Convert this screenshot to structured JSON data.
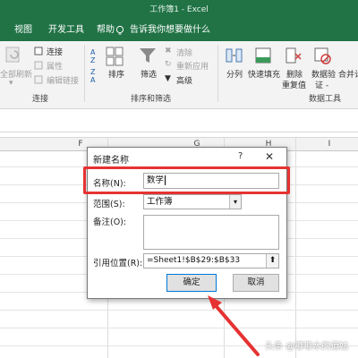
{
  "window": {
    "title": "工作簿1  -  Excel"
  },
  "tabs": [
    {
      "label": "视图"
    },
    {
      "label": "开发工具"
    },
    {
      "label": "帮助"
    }
  ],
  "tell_me": "告诉我你想要做什么",
  "ribbon": {
    "connections": {
      "refresh_all": "全部刷新",
      "connections": "连接",
      "properties": "属性",
      "edit_links": "编辑链接",
      "group_label": "连接"
    },
    "sort_filter": {
      "sort": "排序",
      "filter": "筛选",
      "clear": "清除",
      "reapply": "重新应用",
      "advanced": "高级",
      "group_label": "排序和筛选"
    },
    "data_tools": {
      "text_to_columns": "分列",
      "flash_fill": "快速填充",
      "remove_duplicates_1": "删除",
      "remove_duplicates_2": "重复值",
      "data_validation_1": "数据验",
      "data_validation_2": "证 -",
      "consolidate": "合并计",
      "group_label": "数据工具"
    }
  },
  "grid": {
    "columns": [
      "F",
      "G",
      "H",
      "I"
    ]
  },
  "dialog": {
    "title": "新建名称",
    "help": "?",
    "close": "✕",
    "name_label": "名称(N):",
    "name_value": "数学",
    "scope_label": "范围(S):",
    "scope_value": "工作簿",
    "comment_label": "备注(O):",
    "refers_label": "引用位置(R):",
    "refers_value": "=Sheet1!$B$29:$B$33",
    "ok": "确定",
    "cancel": "取消"
  },
  "watermark": "头条 @嘟嘟水的道姑",
  "colors": {
    "excel_green": "#217346",
    "highlight_red": "#e63232",
    "arrow_red": "#e63232"
  }
}
